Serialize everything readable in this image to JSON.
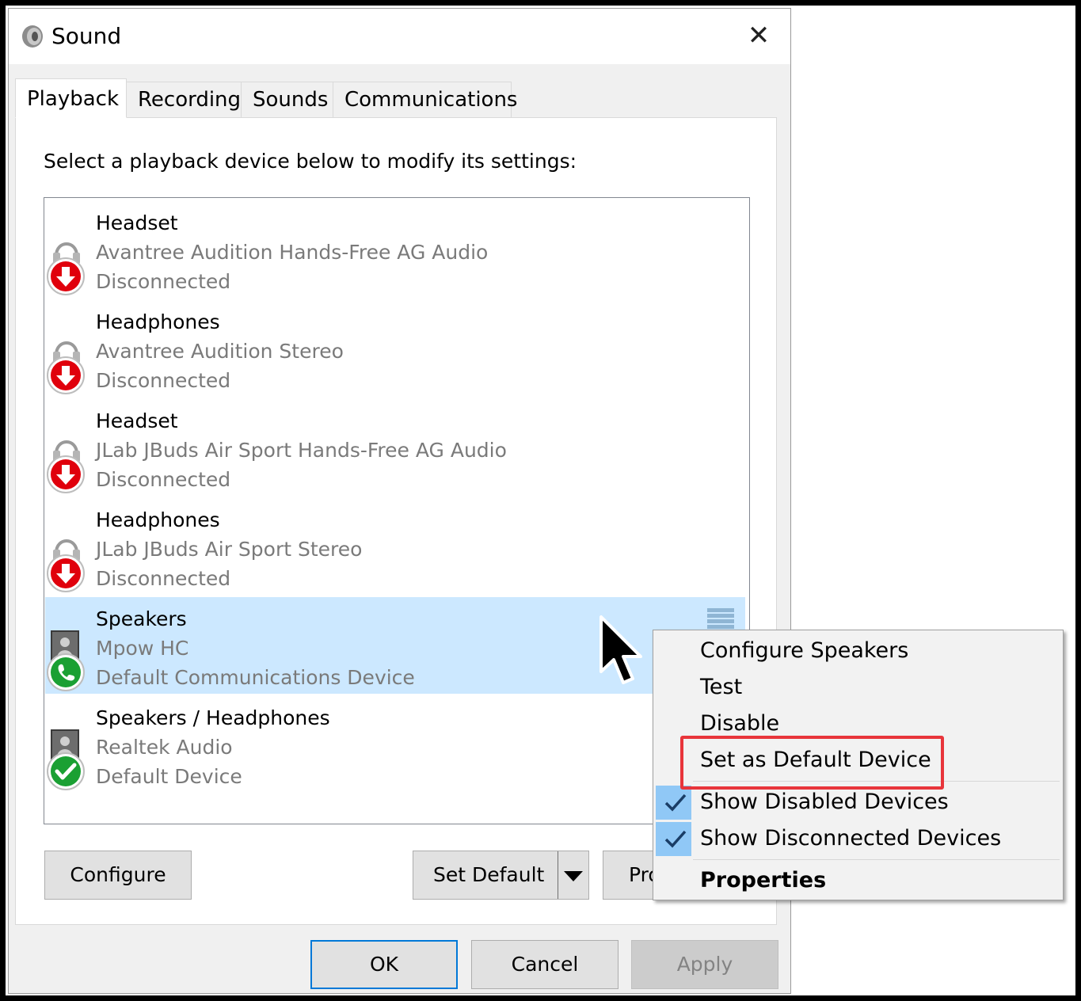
{
  "window": {
    "title": "Sound",
    "close_glyph": "✕"
  },
  "tabs": [
    {
      "label": "Playback",
      "active": true
    },
    {
      "label": "Recording"
    },
    {
      "label": "Sounds"
    },
    {
      "label": "Communications"
    }
  ],
  "instruction": "Select a playback device below to modify its settings:",
  "devices": [
    {
      "name": "Headset",
      "desc": "Avantree Audition Hands-Free AG Audio",
      "status": "Disconnected",
      "icon": "headset-disconnected-icon"
    },
    {
      "name": "Headphones",
      "desc": "Avantree Audition Stereo",
      "status": "Disconnected",
      "icon": "headphones-disconnected-icon"
    },
    {
      "name": "Headset",
      "desc": "JLab JBuds Air Sport Hands-Free AG Audio",
      "status": "Disconnected",
      "icon": "headset-disconnected-icon"
    },
    {
      "name": "Headphones",
      "desc": "JLab JBuds Air Sport Stereo",
      "status": "Disconnected",
      "icon": "headphones-disconnected-icon"
    },
    {
      "name": "Speakers",
      "desc": "Mpow HC",
      "status": "Default Communications Device",
      "icon": "speaker-communications-icon",
      "selected": true
    },
    {
      "name": "Speakers / Headphones",
      "desc": "Realtek Audio",
      "status": "Default Device",
      "icon": "speaker-default-icon"
    }
  ],
  "buttons": {
    "configure": "Configure",
    "set_default": "Set Default",
    "properties_partial": "Pro",
    "ok": "OK",
    "cancel": "Cancel",
    "apply": "Apply"
  },
  "context_menu": {
    "items": [
      {
        "label": "Configure Speakers"
      },
      {
        "label": "Test"
      },
      {
        "label": "Disable"
      },
      {
        "label": "Set as Default Device",
        "highlighted": true
      },
      {
        "label": "Show Disabled Devices",
        "checked": true
      },
      {
        "label": "Show Disconnected Devices",
        "checked": true
      },
      {
        "label": "Properties",
        "bold": true
      }
    ]
  },
  "colors": {
    "selection": "#cce8ff",
    "highlight_box": "#e8353b",
    "check_bg": "#90c8f6",
    "disconnected_badge": "#e0000c",
    "default_badge": "#1aa033"
  }
}
